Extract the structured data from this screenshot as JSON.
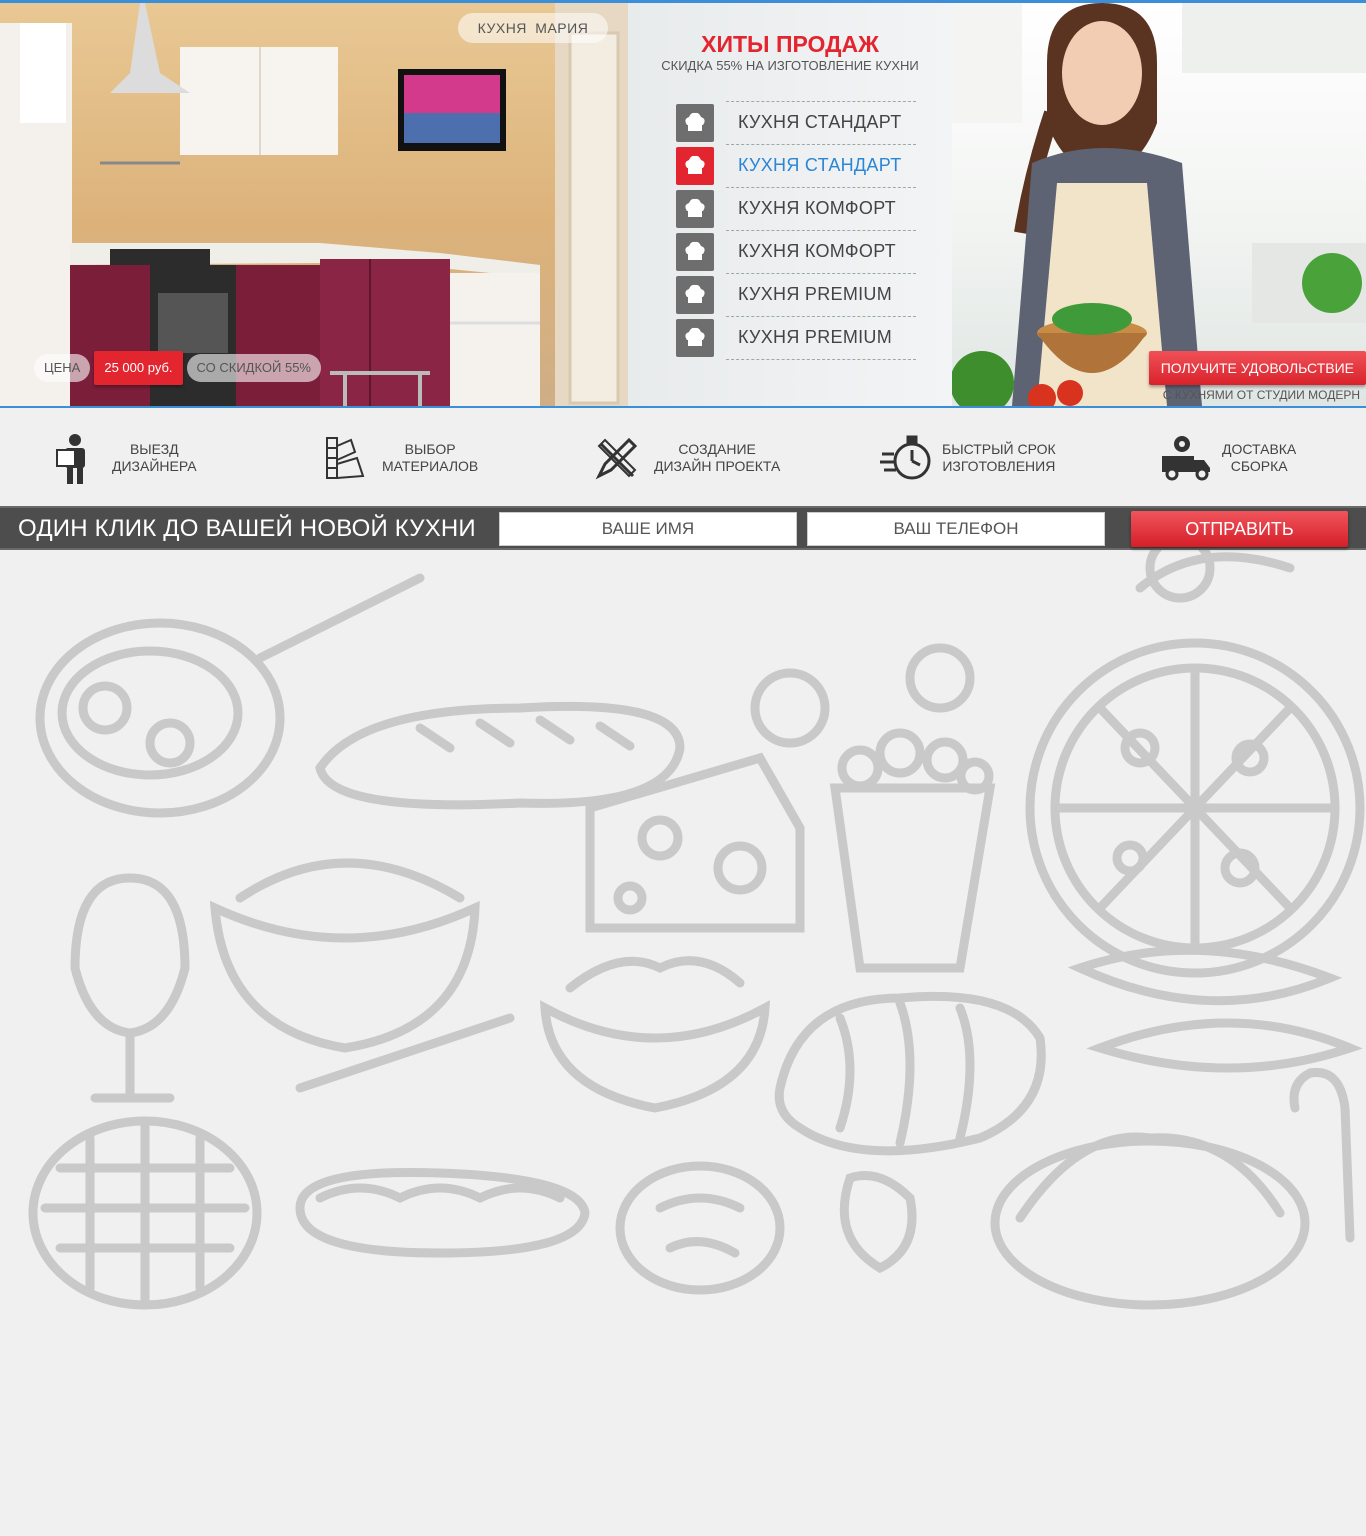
{
  "hero": {
    "kitchen_name": "КУХНЯ  МАРИЯ",
    "price_label": "ЦЕНА",
    "price_value": "25 000 руб.",
    "price_note": "СО СКИДКОЙ 55%",
    "hits_title": "ХИТЫ ПРОДАЖ",
    "hits_subtitle": "СКИДКА 55% НА ИЗГОТОВЛЕНИЕ КУХНИ",
    "hits": [
      {
        "label": "КУХНЯ СТАНДАРТ",
        "active": false
      },
      {
        "label": "КУХНЯ СТАНДАРТ",
        "active": true
      },
      {
        "label": "КУХНЯ КОМФОРТ",
        "active": false
      },
      {
        "label": "КУХНЯ КОМФОРТ",
        "active": false
      },
      {
        "label": "КУХНЯ PREMIUM",
        "active": false
      },
      {
        "label": "КУХНЯ PREMIUM",
        "active": false
      }
    ],
    "cta_button": "ПОЛУЧИТЕ УДОВОЛЬСТВИЕ",
    "cta_sub": "С КУХНЯМИ ОТ СТУДИИ МОДЕРН"
  },
  "features": [
    {
      "line1": "ВЫЕЗД",
      "line2": "ДИЗАЙНЕРА",
      "icon": "designer-icon"
    },
    {
      "line1": "ВЫБОР",
      "line2": "МАТЕРИАЛОВ",
      "icon": "palette-icon"
    },
    {
      "line1": "СОЗДАНИЕ",
      "line2": "ДИЗАЙН ПРОЕКТА",
      "icon": "pencil-ruler-icon"
    },
    {
      "line1": "БЫСТРЫЙ СРОК",
      "line2": "ИЗГОТОВЛЕНИЯ",
      "icon": "stopwatch-icon"
    },
    {
      "line1": "ДОСТАВКА",
      "line2": "СБОРКА",
      "icon": "truck-gear-icon"
    }
  ],
  "form": {
    "title": "ОДИН КЛИК ДО ВАШЕЙ НОВОЙ КУХНИ",
    "name_placeholder": "ВАШЕ ИМЯ",
    "phone_placeholder": "ВАШ ТЕЛЕФОН",
    "submit": "ОТПРАВИТЬ"
  },
  "colors": {
    "accent_red": "#e3252f",
    "accent_blue": "#2a86d6",
    "bar_gray": "#4d4d4d"
  }
}
